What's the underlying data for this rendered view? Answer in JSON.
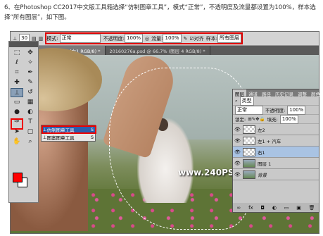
{
  "caption": "6、在Photoshop CC2017中文版工具箱选择“仿制图章工具”，模式“正常”，不透明度及流量都设置为100%，样本选择“所有图层”，如下图。",
  "options_bar": {
    "mode_label": "模式:",
    "mode_value": "正常",
    "opacity_label": "不透明度:",
    "opacity_value": "100%",
    "flow_label": "流量:",
    "flow_value": "100%",
    "align_label": "对齐",
    "sample_label": "样本:",
    "sample_value": "所有图层",
    "brush_size": "30"
  },
  "tabs": [
    {
      "label": "20160276.psd @ 200% (右1 RGB/8) *"
    },
    {
      "label": "20160276a.psd @ 66.7% (图层 4 RGB/8) *"
    }
  ],
  "watermark": "www.240PS.com",
  "flyout": {
    "items": [
      {
        "label": "仿制图章工具",
        "key": "S"
      },
      {
        "label": "图案图章工具",
        "key": "S"
      }
    ]
  },
  "layers_panel": {
    "tabs": [
      "图层",
      "通道",
      "路径",
      "历史记录",
      "调整",
      "颜色"
    ],
    "filter_label": "类型",
    "blend_mode": "正常",
    "opacity_label": "不透明度:",
    "opacity_value": "100%",
    "lock_label": "锁定:",
    "fill_label": "填充:",
    "fill_value": "100%",
    "layers": [
      {
        "name": "左2",
        "active": false
      },
      {
        "name": "左1 + 汽车",
        "active": false
      },
      {
        "name": "右1",
        "active": true
      },
      {
        "name": "图层 1",
        "active": false
      },
      {
        "name": "背景",
        "active": false
      }
    ],
    "footer_icons": [
      "link-icon",
      "fx-icon",
      "mask-icon",
      "adjustment-icon",
      "folder-icon",
      "new-layer-icon",
      "trash-icon"
    ]
  },
  "colors": {
    "foreground": "#ff0000",
    "background": "#ffffff",
    "highlight": "#e00000"
  }
}
